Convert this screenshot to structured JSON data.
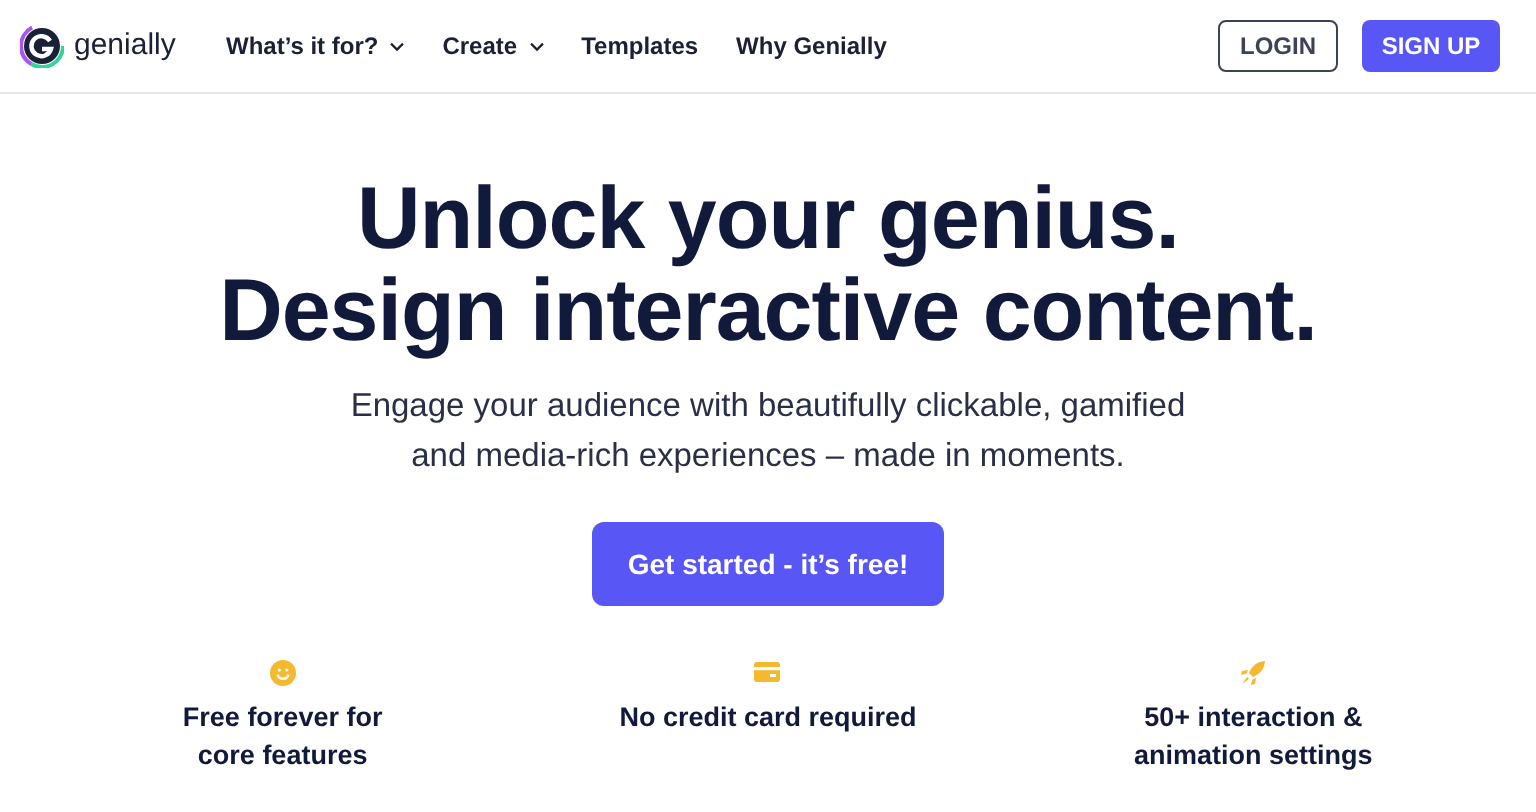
{
  "logo": {
    "text": "genially"
  },
  "nav": [
    {
      "label": "What’s it for?",
      "dropdown": true
    },
    {
      "label": "Create",
      "dropdown": true
    },
    {
      "label": "Templates",
      "dropdown": false
    },
    {
      "label": "Why Genially",
      "dropdown": false
    }
  ],
  "actions": [
    {
      "kind": "outline",
      "label": "LOGIN"
    },
    {
      "kind": "filled",
      "label": "SIGN UP"
    }
  ],
  "hero": {
    "headline": [
      "Unlock your genius.",
      "Design interactive content."
    ],
    "subtitle": [
      "Engage your audience with beautifully clickable, gamified",
      "and media-rich experiences – made in moments."
    ],
    "cta": "Get started - it’s free!"
  },
  "features": [
    {
      "kind": "smile",
      "lines": [
        "Free forever for",
        "core features"
      ]
    },
    {
      "kind": "card",
      "lines": [
        "No credit card required"
      ]
    },
    {
      "kind": "rocket",
      "lines": [
        "50+ interaction &",
        "animation settings"
      ]
    }
  ]
}
